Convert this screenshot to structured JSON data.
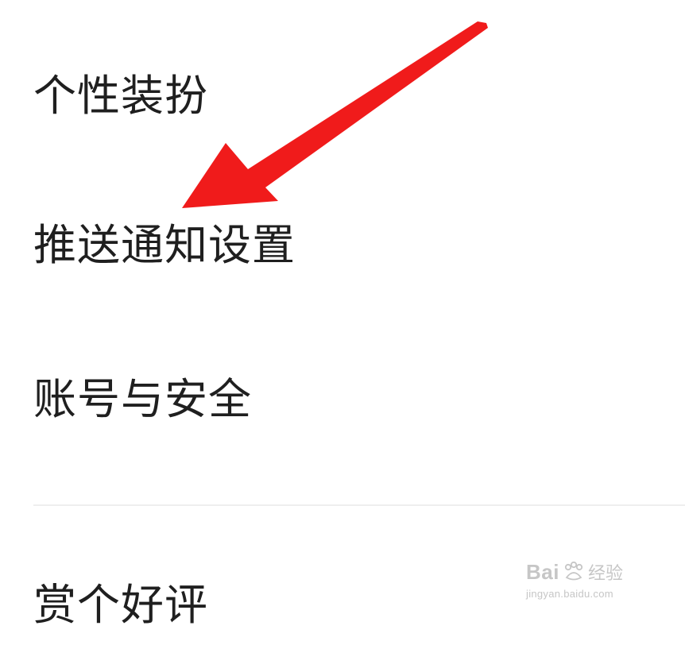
{
  "menu": {
    "items": [
      {
        "label": "个性装扮"
      },
      {
        "label": "推送通知设置"
      },
      {
        "label": "账号与安全"
      },
      {
        "label": "赏个好评"
      }
    ]
  },
  "annotation": {
    "arrow_color": "#f01b1b",
    "arrow_target": "推送通知设置"
  },
  "watermark": {
    "brand": "Bai",
    "brand_suffix": "经验",
    "url": "jingyan.baidu.com"
  },
  "colors": {
    "text": "#1f1f1f",
    "divider": "#eeeeee",
    "background": "#ffffff"
  }
}
